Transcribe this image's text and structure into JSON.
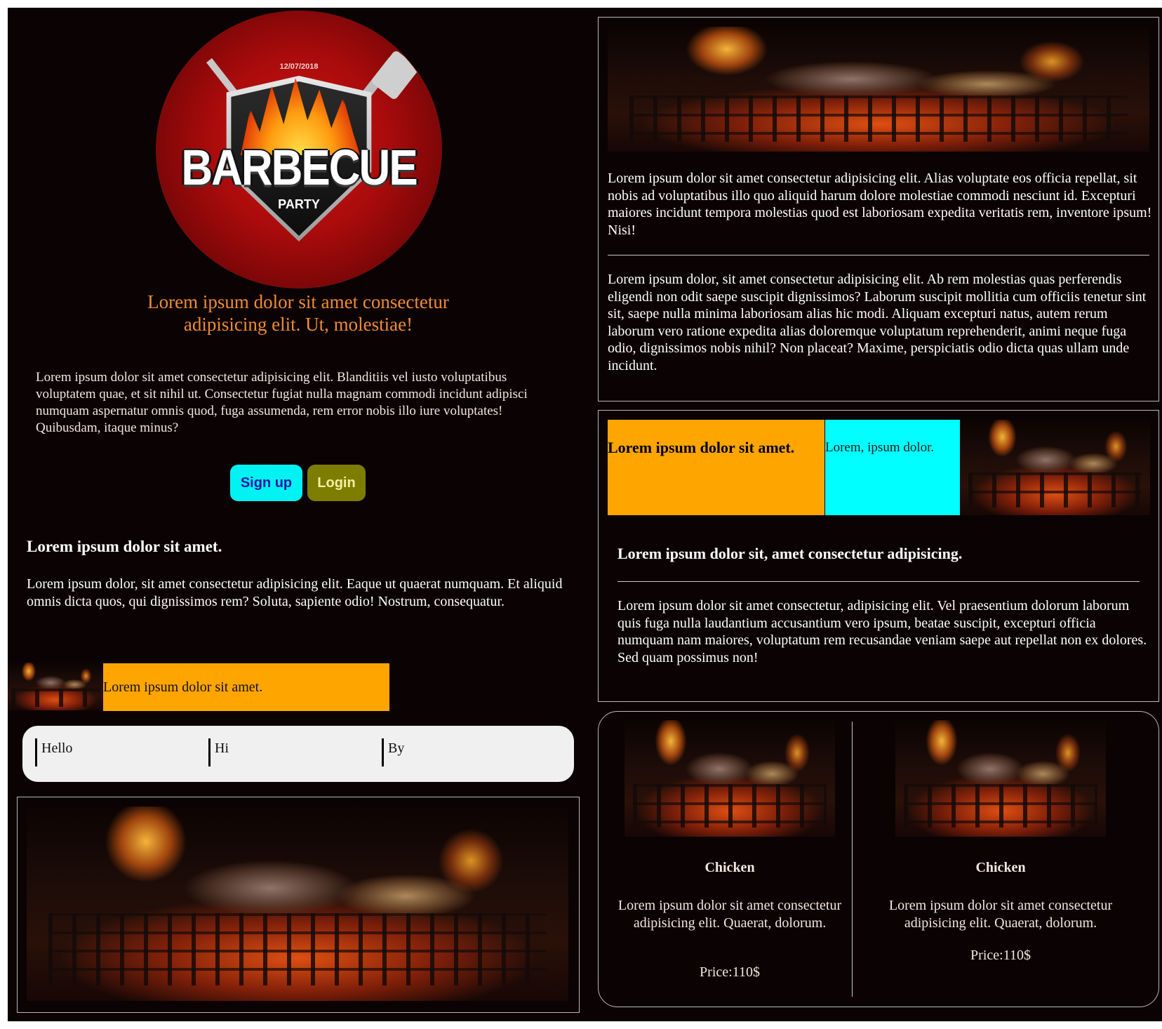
{
  "logo": {
    "date": "12/07/2018",
    "title": "BARBECUE",
    "subtitle": "PARTY"
  },
  "hero": {
    "tagline": "Lorem ipsum dolor sit amet consectetur adipisicing elit. Ut, molestiae!",
    "intro": "Lorem ipsum dolor sit amet consectetur adipisicing elit. Blanditiis vel iusto voluptatibus voluptatem quae, et sit nihil ut. Consectetur fugiat nulla magnam commodi incidunt adipisci numquam aspernatur omnis quod, fuga assumenda, rem error nobis illo iure voluptates! Quibusdam, itaque minus?",
    "signup_label": "Sign up",
    "login_label": "Login"
  },
  "left_section": {
    "heading": "Lorem ipsum dolor sit amet.",
    "paragraph": "Lorem ipsum dolor, sit amet consectetur adipisicing elit. Eaque ut quaerat numquam. Et aliquid omnis dicta quos, qui dignissimos rem? Soluta, sapiente odio! Nostrum, consequatur.",
    "strip_text": "Lorem ipsum dolor sit amet."
  },
  "nav": {
    "items": [
      {
        "label": "Hello"
      },
      {
        "label": "Hi"
      },
      {
        "label": "By"
      }
    ]
  },
  "article": {
    "paragraph1": "Lorem ipsum dolor sit amet consectetur adipisicing elit. Alias voluptate eos officia repellat, sit nobis ad voluptatibus illo quo aliquid harum dolore molestiae commodi nesciunt id. Excepturi maiores incidunt tempora molestias quod est laboriosam expedita veritatis rem, inventore ipsum! Nisi!",
    "paragraph2": "Lorem ipsum dolor, sit amet consectetur adipisicing elit. Ab rem molestias quas perferendis eligendi non odit saepe suscipit dignissimos? Laborum suscipit mollitia cum officiis tenetur sint sit, saepe nulla minima laboriosam alias hic modi. Aliquam excepturi natus, autem rerum laborum vero ratione expedita alias doloremque voluptatum reprehenderit, animi neque fuga odio, dignissimos nobis nihil? Non placeat? Maxime, perspiciatis odio dicta quas ullam unde incidunt."
  },
  "feature": {
    "orange_cell": "Lorem ipsum dolor sit amet.",
    "cyan_cell": "Lorem, ipsum dolor.",
    "heading": "Lorem ipsum dolor sit, amet consectetur adipisicing.",
    "paragraph": "Lorem ipsum dolor sit amet consectetur, adipisicing elit. Vel praesentium dolorum laborum quis fuga nulla laudantium accusantium vero ipsum, beatae suscipit, excepturi officia numquam nam maiores, voluptatum rem recusandae veniam saepe aut repellat non ex dolores. Sed quam possimus non!"
  },
  "cards": [
    {
      "title": "Chicken",
      "description": "Lorem ipsum dolor sit amet consectetur adipisicing elit. Quaerat, dolorum.",
      "price": "Price:110$"
    },
    {
      "title": "Chicken",
      "description": "Lorem ipsum dolor sit amet consectetur adipisicing elit. Quaerat, dolorum.",
      "price": "Price:110$"
    }
  ],
  "colors": {
    "page_background": "#0b0203",
    "tagline": "#f08c33",
    "signup_button": "#00f2f2",
    "login_button": "#7d7d00",
    "orange_cell": "#ffa500",
    "cyan_cell": "#00ffff",
    "nav_background": "#f0f0f0"
  }
}
